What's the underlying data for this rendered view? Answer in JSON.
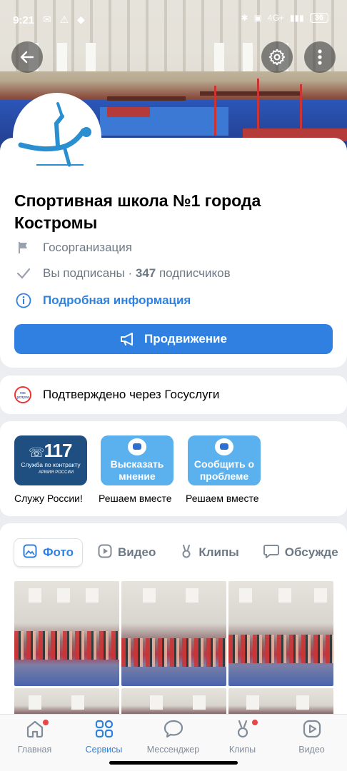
{
  "status_bar": {
    "time": "9:21",
    "battery": "36",
    "network": "4G+"
  },
  "header": {
    "back_icon": "arrow-left-icon",
    "settings_icon": "gear-icon",
    "menu_icon": "more-vertical-icon"
  },
  "profile": {
    "title": "Спортивная школа №1 города Костромы",
    "type": "Госорганизация",
    "subscribed": "Вы подписаны",
    "separator": " · ",
    "subscribers_count": "347",
    "subscribers_label": " подписчиков",
    "details_link": "Подробная информация",
    "promo_button": "Продвижение"
  },
  "verification": {
    "text": "Подтверждено через Госуслуги",
    "logo_text": "гос услуги"
  },
  "widgets": [
    {
      "tile_number": "117",
      "tile_text": "Служба по контракту",
      "tile_sub": "АРМИЯ РОССИИ",
      "caption": "Служу России!"
    },
    {
      "tile_text": "Высказать мнение",
      "caption": "Решаем вместе"
    },
    {
      "tile_text": "Сообщить о проблеме",
      "caption": "Решаем вместе"
    }
  ],
  "content_tabs": [
    {
      "label": "Фото",
      "icon": "photo-icon",
      "active": true
    },
    {
      "label": "Видео",
      "icon": "video-icon",
      "active": false
    },
    {
      "label": "Клипы",
      "icon": "clips-icon",
      "active": false
    },
    {
      "label": "Обсужде",
      "icon": "discussion-icon",
      "active": false
    }
  ],
  "bottom_nav": [
    {
      "label": "Главная",
      "icon": "home-icon",
      "badge": true
    },
    {
      "label": "Сервисы",
      "icon": "services-icon",
      "active": true
    },
    {
      "label": "Мессенджер",
      "icon": "messenger-icon"
    },
    {
      "label": "Клипы",
      "icon": "clips-icon",
      "badge": true
    },
    {
      "label": "Видео",
      "icon": "video-icon"
    }
  ],
  "colors": {
    "accent": "#2d81e0",
    "button": "#2f80e0",
    "badge": "#e64646"
  }
}
